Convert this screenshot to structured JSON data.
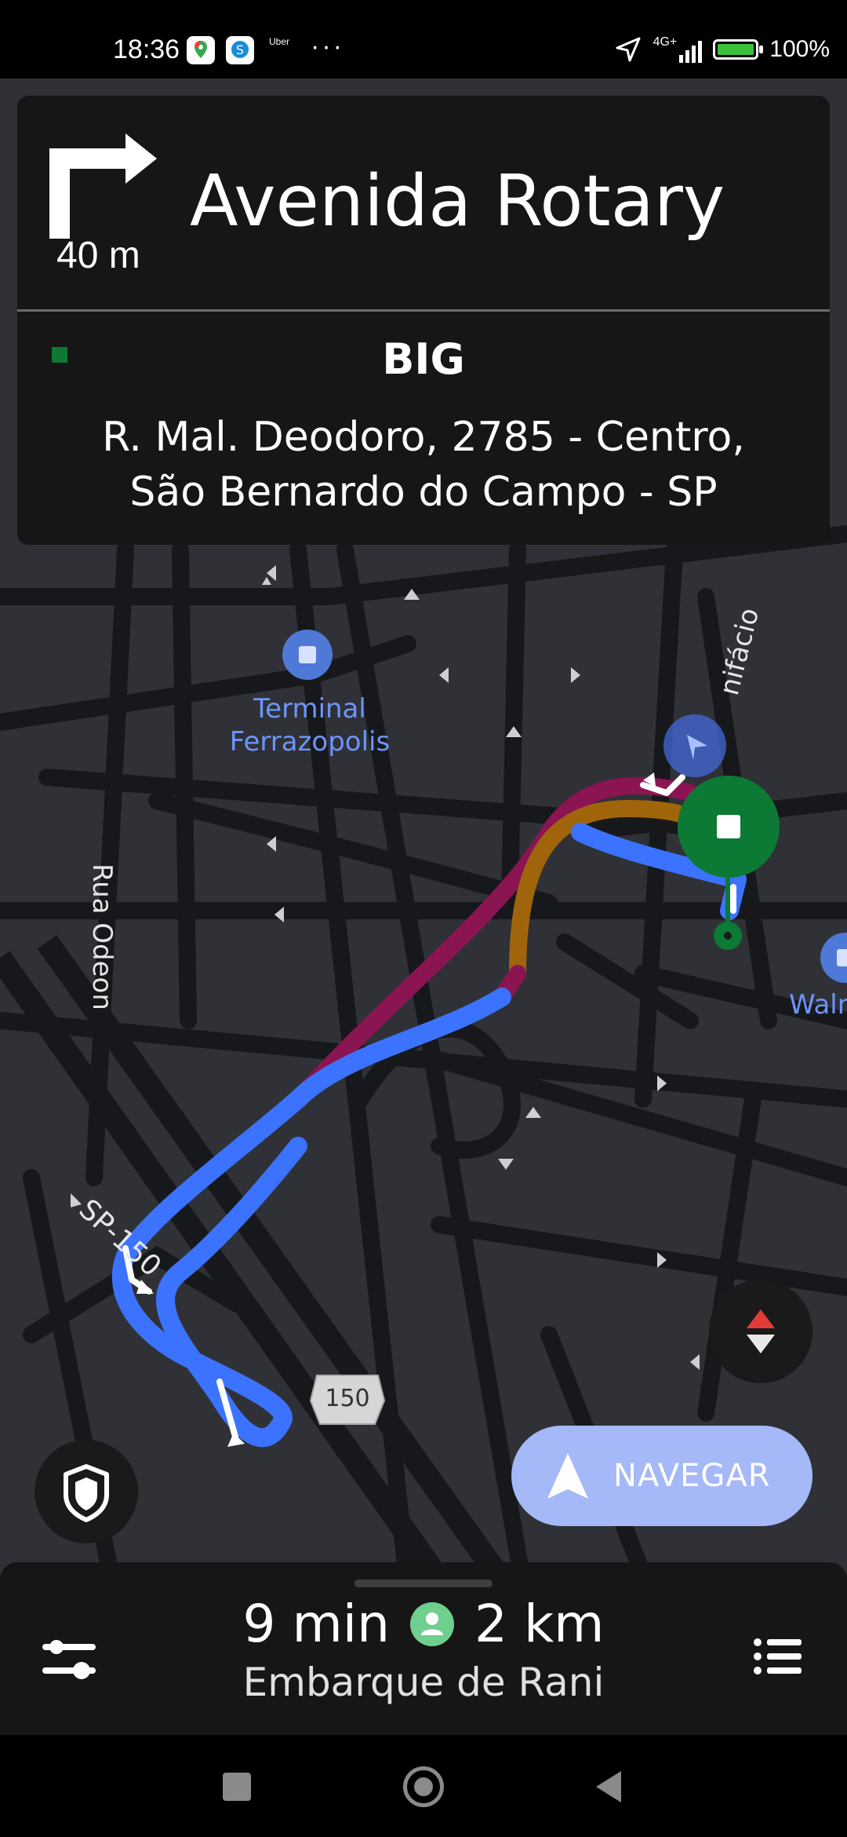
{
  "status_bar": {
    "time": "18:36",
    "network": "4G+",
    "battery": "100%",
    "notification_icons": [
      "maps-icon",
      "s-app-icon",
      "uber-icon"
    ],
    "uber_label": "Uber",
    "more_indicator": "···"
  },
  "navigation": {
    "turn_direction": "right",
    "turn_distance": "40 m",
    "street": "Avenida Rotary"
  },
  "destination": {
    "name": "BIG",
    "address_line1": "R. Mal. Deodoro, 2785 - Centro,",
    "address_line2": "São Bernardo do Campo - SP",
    "marker_color": "#0c7a34"
  },
  "map": {
    "poi_terminal": [
      "Terminal",
      "Ferrazopolis"
    ],
    "poi_walmart": "Walr",
    "street_odeon": "Rua Odeon",
    "street_sp150": "SP-150",
    "street_bonifacio": "nifácio",
    "highway_shield": "150",
    "route_colors": {
      "primary": "#3b73ff",
      "traffic_heavy": "#8b1452",
      "traffic_medium": "#a0650a"
    }
  },
  "actions": {
    "navegar": "NAVEGAR"
  },
  "trip": {
    "eta": "9 min",
    "distance": "2 km",
    "subtitle": "Embarque de Rani"
  }
}
